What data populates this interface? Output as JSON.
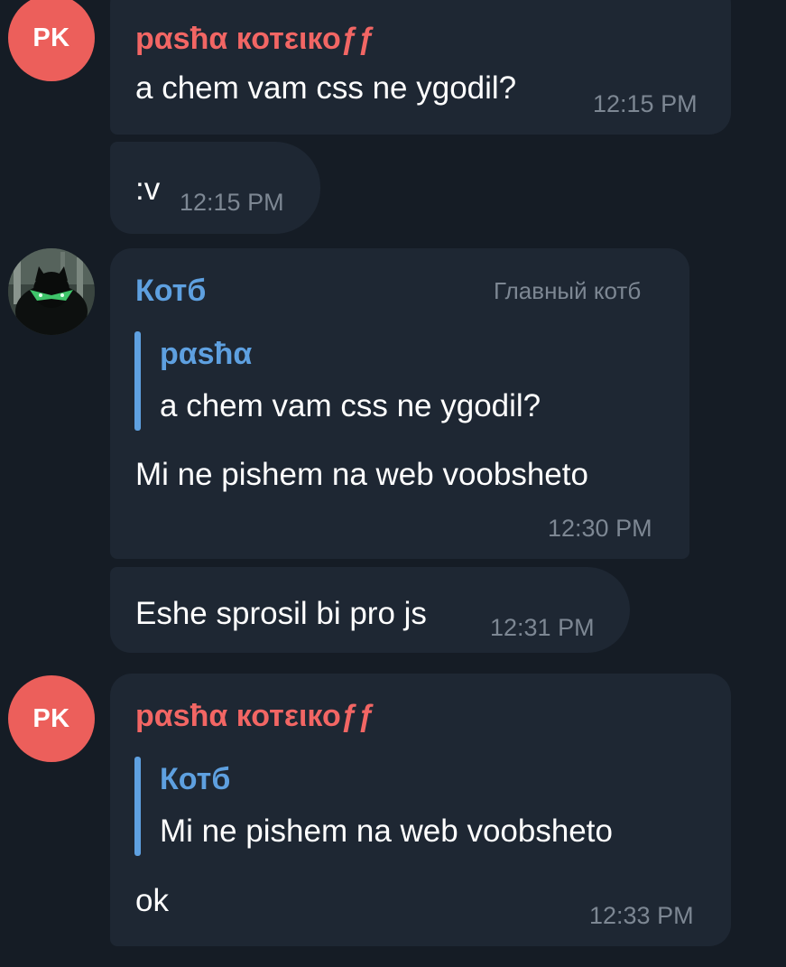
{
  "messages": [
    {
      "sender": "рαѕħα котειкоƒƒ",
      "avatar_initials": "PK",
      "text": "a chem vam css ne ygodil?",
      "time": "12:15 PM"
    },
    {
      "text": ":v",
      "time": "12:15 PM"
    },
    {
      "sender": "Котб",
      "rank": "Главный котб",
      "reply": {
        "name": "рαѕħα",
        "text": "a chem vam css ne ygodil?"
      },
      "text": "Mi ne pishem na web voobsheto",
      "time": "12:30 PM"
    },
    {
      "text": "Eshe sprosil bi pro js",
      "time": "12:31 PM"
    },
    {
      "sender": "рαѕħα котειкоƒƒ",
      "avatar_initials": "PK",
      "reply": {
        "name": "Котб",
        "text": "Mi ne pishem na web voobsheto"
      },
      "text": "ok",
      "time": "12:33 PM"
    }
  ],
  "colors": {
    "background": "#151c25",
    "bubble": "#1e2733",
    "accent_red": "#f26664",
    "accent_blue": "#5ea0e0",
    "avatar_red": "#ec5f5b",
    "time": "#7d8793"
  }
}
